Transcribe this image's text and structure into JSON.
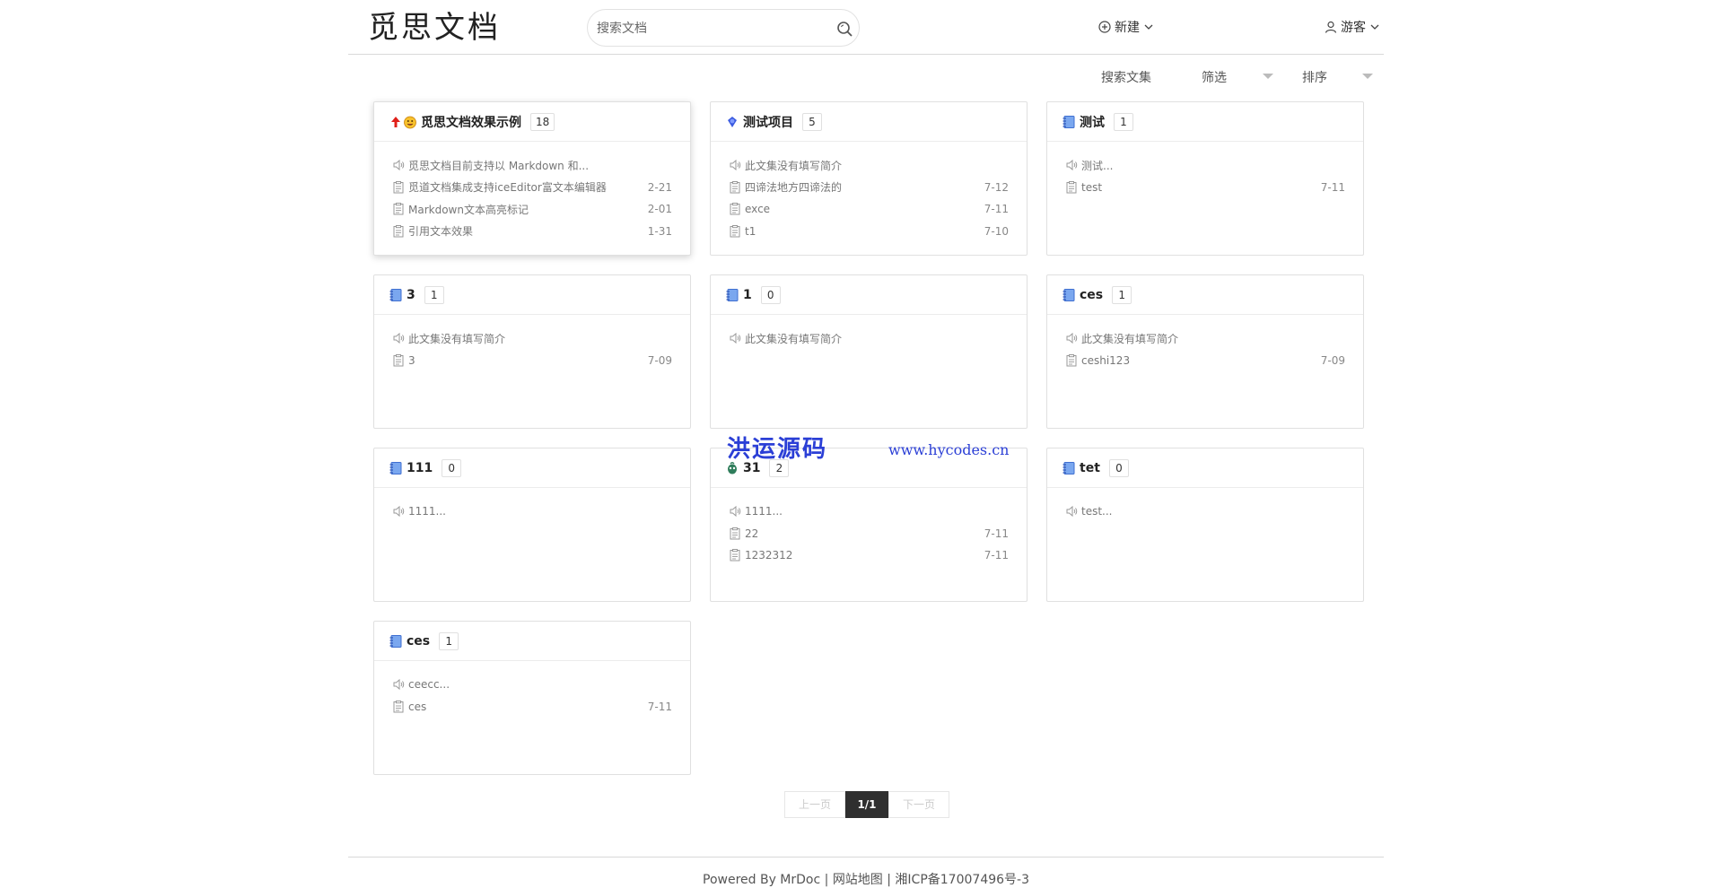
{
  "header": {
    "logo": "觅思文档",
    "search_placeholder": "搜索文档",
    "new_label": "新建",
    "user_label": "游客"
  },
  "toolbar": {
    "search_label": "搜索文集",
    "filter_label": "筛选",
    "sort_label": "排序"
  },
  "cards": [
    {
      "title": "觅思文档效果示例",
      "count": "18",
      "icon": "pin-emoji-icon",
      "intro": "觅思文档目前支持以 Markdown 和...",
      "docs": [
        {
          "title": "觅道文档集成支持iceEditor富文本编辑器",
          "date": "2-21"
        },
        {
          "title": "Markdown文本高亮标记",
          "date": "2-01"
        },
        {
          "title": "引用文本效果",
          "date": "1-31"
        }
      ]
    },
    {
      "title": "测试项目",
      "count": "5",
      "icon": "blue-gem-icon",
      "intro": "此文集没有填写简介",
      "docs": [
        {
          "title": "四谛法地方四谛法的",
          "date": "7-12"
        },
        {
          "title": "exce",
          "date": "7-11"
        },
        {
          "title": "t1",
          "date": "7-10"
        }
      ]
    },
    {
      "title": "测试",
      "count": "1",
      "icon": "notebook-icon",
      "intro": "测试...",
      "docs": [
        {
          "title": "test",
          "date": "7-11"
        }
      ]
    },
    {
      "title": "3",
      "count": "1",
      "icon": "notebook-icon",
      "intro": "此文集没有填写简介",
      "docs": [
        {
          "title": "3",
          "date": "7-09"
        }
      ]
    },
    {
      "title": "1",
      "count": "0",
      "icon": "notebook-icon",
      "intro": "此文集没有填写简介",
      "docs": []
    },
    {
      "title": "ces",
      "count": "1",
      "icon": "notebook-icon",
      "intro": "此文集没有填写简介",
      "docs": [
        {
          "title": "ceshi123",
          "date": "7-09"
        }
      ]
    },
    {
      "title": "111",
      "count": "0",
      "icon": "notebook-icon",
      "intro": "1111...",
      "docs": []
    },
    {
      "title": "31",
      "count": "2",
      "icon": "green-emoji-icon",
      "intro": "1111...",
      "docs": [
        {
          "title": "22",
          "date": "7-11"
        },
        {
          "title": "1232312",
          "date": "7-11"
        }
      ]
    },
    {
      "title": "tet",
      "count": "0",
      "icon": "notebook-icon",
      "intro": "test...",
      "docs": []
    },
    {
      "title": "ces",
      "count": "1",
      "icon": "notebook-icon",
      "intro": "ceecc...",
      "docs": [
        {
          "title": "ces",
          "date": "7-11"
        }
      ]
    }
  ],
  "watermark": {
    "cn": "洪运源码",
    "url": "www.hycodes.cn"
  },
  "pagination": {
    "prev": "上一页",
    "current": "1/1",
    "next": "下一页"
  },
  "footer": {
    "powered": "Powered By MrDoc |",
    "sitemap": "网站地图",
    "icp": "| 湘ICP备17007496号-3"
  }
}
